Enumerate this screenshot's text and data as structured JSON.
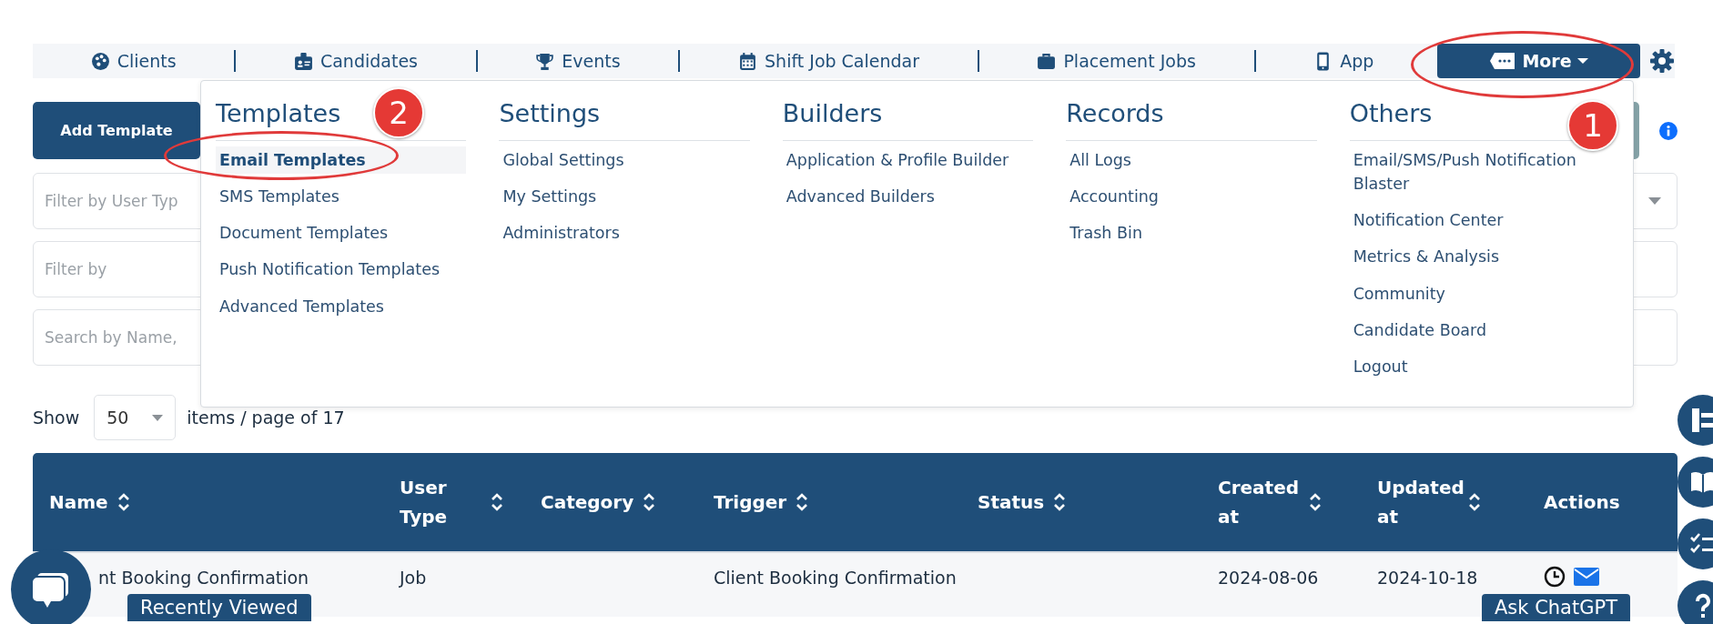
{
  "nav": {
    "items": [
      {
        "label": "Clients"
      },
      {
        "label": "Candidates"
      },
      {
        "label": "Events"
      },
      {
        "label": "Shift Job Calendar"
      },
      {
        "label": "Placement Jobs"
      },
      {
        "label": "App"
      }
    ],
    "more": {
      "label": "More",
      "expanded": true
    }
  },
  "mega_menu": {
    "columns": [
      {
        "title": "Templates",
        "items": [
          {
            "label": "Email Templates",
            "selected": true
          },
          {
            "label": "SMS Templates",
            "selected": false
          },
          {
            "label": "Document Templates",
            "selected": false
          },
          {
            "label": "Push Notification Templates",
            "selected": false
          },
          {
            "label": "Advanced Templates",
            "selected": false
          }
        ]
      },
      {
        "title": "Settings",
        "items": [
          {
            "label": "Global Settings",
            "selected": false
          },
          {
            "label": "My Settings",
            "selected": false
          },
          {
            "label": "Administrators",
            "selected": false
          }
        ]
      },
      {
        "title": "Builders",
        "items": [
          {
            "label": "Application & Profile Builder",
            "selected": false
          },
          {
            "label": "Advanced Builders",
            "selected": false
          }
        ]
      },
      {
        "title": "Records",
        "items": [
          {
            "label": "All Logs",
            "selected": false
          },
          {
            "label": "Accounting",
            "selected": false
          },
          {
            "label": "Trash Bin",
            "selected": false
          }
        ]
      },
      {
        "title": "Others",
        "items": [
          {
            "label": "Email/SMS/Push Notification Blaster",
            "selected": false
          },
          {
            "label": "Notification Center",
            "selected": false
          },
          {
            "label": "Metrics & Analysis",
            "selected": false
          },
          {
            "label": "Community",
            "selected": false
          },
          {
            "label": "Candidate Board",
            "selected": false
          },
          {
            "label": "Logout",
            "selected": false
          }
        ]
      }
    ]
  },
  "toolbar": {
    "add_button": "Add Template"
  },
  "filters": [
    {
      "placeholder": "Filter by User Typ",
      "kind": "select"
    },
    {
      "placeholder": "Filter by",
      "kind": "input"
    },
    {
      "placeholder": "Search by Name,",
      "kind": "input"
    }
  ],
  "pagination": {
    "show": "Show",
    "page_size": "50",
    "suffix": "items / page of 17"
  },
  "table": {
    "columns": [
      {
        "label": "Name",
        "sortable": true
      },
      {
        "label": "User Type",
        "sortable": true
      },
      {
        "label": "Category",
        "sortable": true
      },
      {
        "label": "Trigger",
        "sortable": true
      },
      {
        "label": "Status",
        "sortable": true
      },
      {
        "label": "Created at",
        "sortable": true
      },
      {
        "label": "Updated at",
        "sortable": true
      },
      {
        "label": "Actions",
        "sortable": false
      }
    ],
    "rows": [
      {
        "cells": [
          "nt Booking Confirmation",
          "Job",
          null,
          "Client Booking Confirmation",
          null,
          "2024-08-06",
          "2024-10-18"
        ]
      }
    ]
  },
  "floating": {
    "recently_viewed": "Recently Viewed",
    "ask": "Ask ChatGPT"
  },
  "annotations": [
    {
      "number": "2"
    },
    {
      "number": "1"
    }
  ]
}
